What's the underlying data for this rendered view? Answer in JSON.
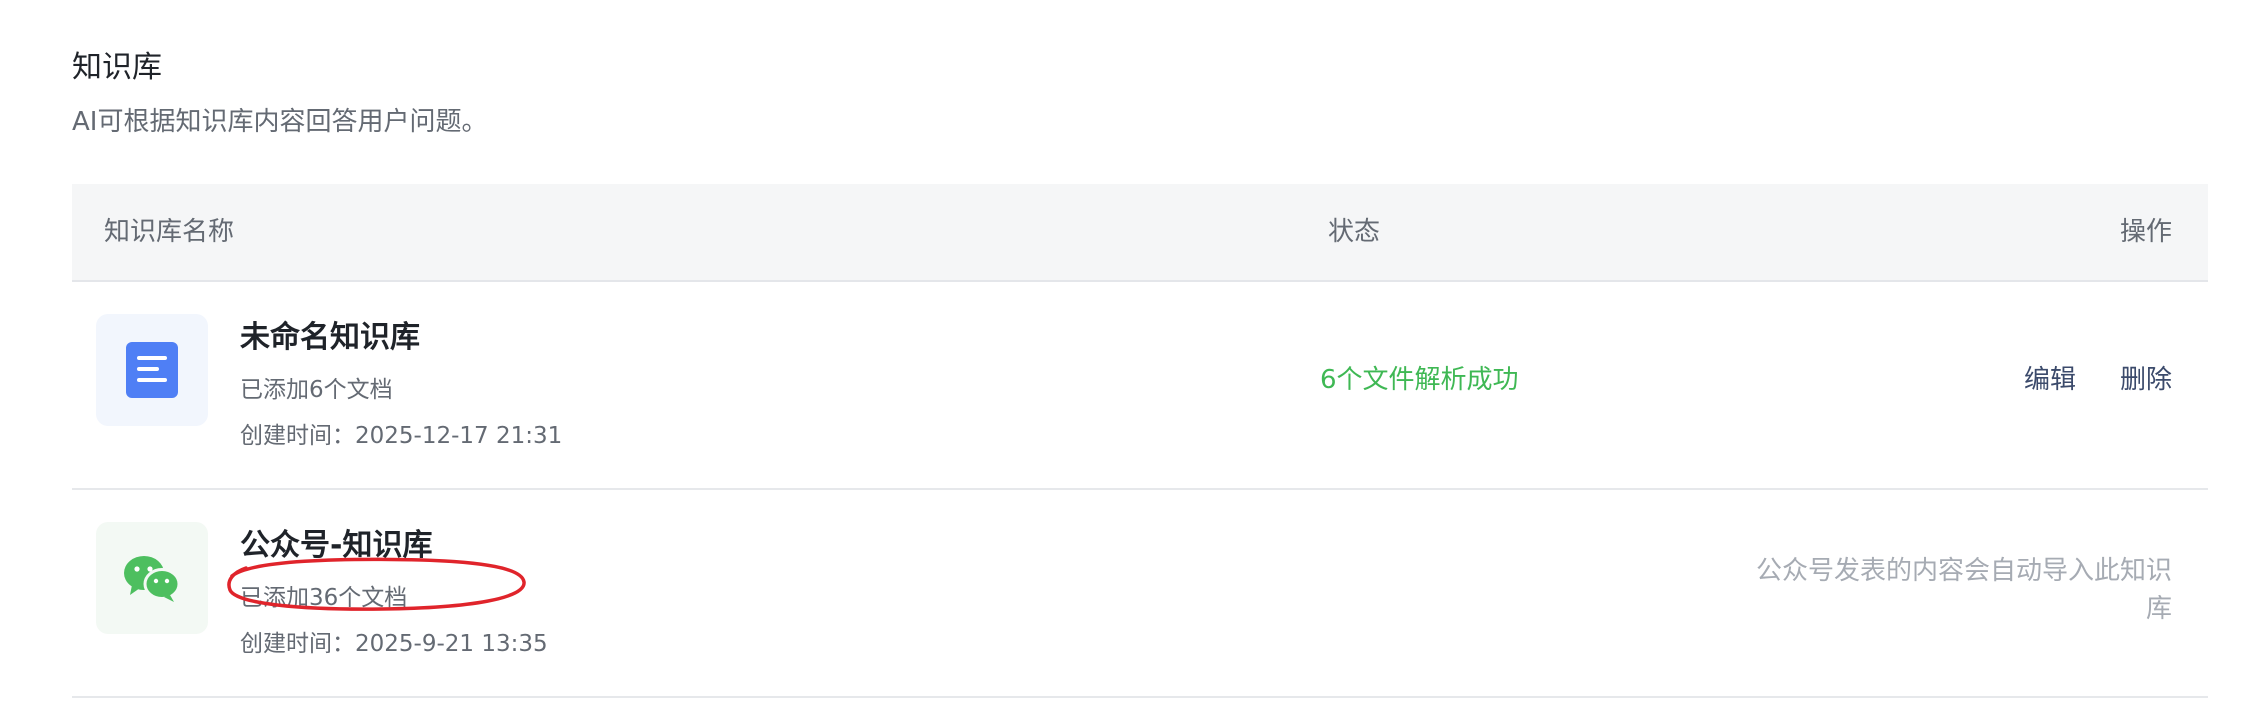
{
  "page": {
    "title": "知识库",
    "subtitle": "AI可根据知识库内容回答用户问题。"
  },
  "table": {
    "headers": {
      "name": "知识库名称",
      "status": "状态",
      "actions": "操作"
    },
    "rows": [
      {
        "icon": "document-icon",
        "title": "未命名知识库",
        "doc_count": "已添加6个文档",
        "created": "创建时间：2025-12-17 21:31",
        "status": "6个文件解析成功",
        "actions": {
          "edit": "编辑",
          "delete": "删除"
        }
      },
      {
        "icon": "wechat-icon",
        "title": "公众号-知识库",
        "doc_count": "已添加36个文档",
        "created": "创建时间：2025-9-21 13:35",
        "note": "公众号发表的内容会自动导入此知识库"
      }
    ]
  },
  "colors": {
    "status_success": "#3fb854",
    "action_link": "#3b4a6b",
    "annotation_circle": "#e0242b",
    "doc_icon_blue": "#4f7ff5",
    "wechat_green": "#4dbf5f"
  }
}
